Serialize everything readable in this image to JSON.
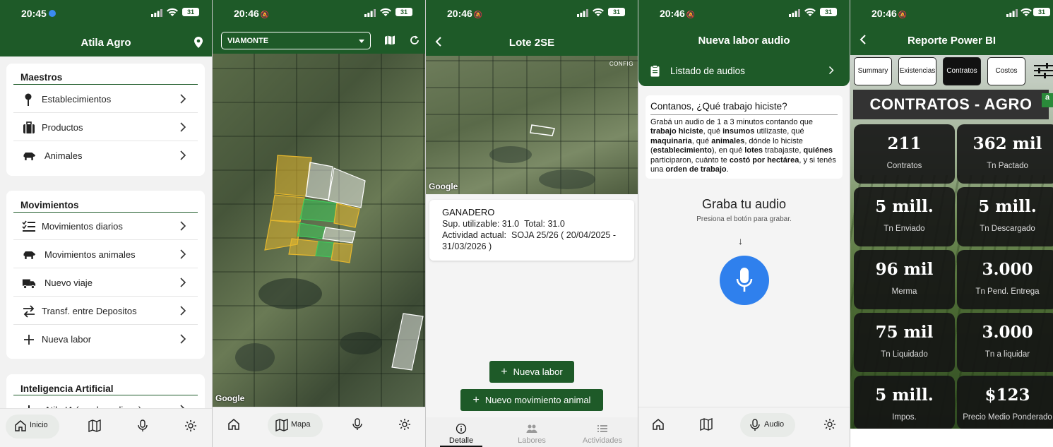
{
  "colors": {
    "brand_green": "#1e5a28",
    "mic_blue": "#2f80ed",
    "map_polygon_yellow": "#e6b82e",
    "map_polygon_green": "#3ec85a"
  },
  "screen1": {
    "status_time": "20:45",
    "battery": "31",
    "title": "Atila Agro",
    "sections": [
      {
        "title": "Maestros",
        "items": [
          {
            "label": "Establecimientos",
            "icon": "pin-icon"
          },
          {
            "label": "Productos",
            "icon": "briefcase-icon"
          },
          {
            "label": "Animales",
            "icon": "cow-icon"
          }
        ]
      },
      {
        "title": "Movimientos",
        "items": [
          {
            "label": "Movimientos diarios",
            "icon": "checklist-icon"
          },
          {
            "label": "Movimientos animales",
            "icon": "cow-icon"
          },
          {
            "label": "Nuevo viaje",
            "icon": "truck-icon"
          },
          {
            "label": "Transf. entre Depositos",
            "icon": "swap-icon"
          },
          {
            "label": "Nueva labor",
            "icon": "plus-icon"
          }
        ]
      },
      {
        "title": "Inteligencia Artificial",
        "items": [
          {
            "label": "Atila IA (ayuda en linea)",
            "icon": "robot-icon"
          }
        ]
      }
    ],
    "nav": {
      "home_label": "Inicio"
    }
  },
  "screen2": {
    "status_time": "20:46",
    "battery": "31",
    "establishment_selected": "VIAMONTE",
    "google_label": "Google",
    "nav": {
      "map_label": "Mapa"
    }
  },
  "screen3": {
    "status_time": "20:46",
    "battery": "31",
    "title": "Lote 2SE",
    "config_label": "CONFIG",
    "google_label": "Google",
    "lot": {
      "name": "GANADERO",
      "usable_label": "Sup. utilizable:",
      "usable_value": "31.0",
      "total_label": "Total:",
      "total_value": "31.0",
      "activity_label": "Actividad actual:",
      "activity_line1": "SOJA 25/26 ( 20/04/2025 -",
      "activity_line2": "31/03/2026 )"
    },
    "btn_new_labor": "Nueva labor",
    "btn_new_animal_move": "Nuevo movimiento animal",
    "tabs": [
      "Detalle",
      "Labores",
      "Actividades"
    ]
  },
  "screen4": {
    "status_time": "20:46",
    "battery": "31",
    "title": "Nueva labor audio",
    "list_label": "Listado de audios",
    "question_title": "Contanos, ¿Qué trabajo hiciste?",
    "instructions": [
      {
        "t": "Grabá un audio de 1 a 3 minutos contando que ",
        "b": false
      },
      {
        "t": "trabajo hiciste",
        "b": true
      },
      {
        "t": ", qué ",
        "b": false
      },
      {
        "t": "insumos",
        "b": true
      },
      {
        "t": " utilizaste, qué ",
        "b": false
      },
      {
        "t": "maquinaria",
        "b": true
      },
      {
        "t": ", qué ",
        "b": false
      },
      {
        "t": "animales",
        "b": true
      },
      {
        "t": ", dónde lo hiciste (",
        "b": false
      },
      {
        "t": "establecimiento",
        "b": true
      },
      {
        "t": "), en qué ",
        "b": false
      },
      {
        "t": "lotes",
        "b": true
      },
      {
        "t": " trabajaste, ",
        "b": false
      },
      {
        "t": "quiénes",
        "b": true
      },
      {
        "t": " participaron, cuánto te ",
        "b": false
      },
      {
        "t": "costó por hectárea",
        "b": true
      },
      {
        "t": ", y si tenés una ",
        "b": false
      },
      {
        "t": "orden de trabajo",
        "b": true
      },
      {
        "t": ".",
        "b": false
      }
    ],
    "record_title": "Graba tu audio",
    "record_hint": "Presiona el botón para grabar.",
    "nav": {
      "audio_label": "Audio"
    }
  },
  "screen5": {
    "status_time": "20:46",
    "battery": "31",
    "title": "Reporte Power BI",
    "tabs": [
      {
        "label": "Summary",
        "active": false
      },
      {
        "label": "Existencias",
        "active": false
      },
      {
        "label": "Contratos",
        "active": true
      },
      {
        "label": "Costos",
        "active": false
      }
    ],
    "report_title": "CONTRATOS - AGRO",
    "kpis": [
      {
        "value": "211",
        "label": "Contratos"
      },
      {
        "value": "362 mil",
        "label": "Tn Pactado"
      },
      {
        "value": "5 mill.",
        "label": "Tn Enviado"
      },
      {
        "value": "5 mill.",
        "label": "Tn Descargado"
      },
      {
        "value": "96 mil",
        "label": "Merma"
      },
      {
        "value": "3.000",
        "label": "Tn Pend. Entrega"
      },
      {
        "value": "75 mil",
        "label": "Tn Liquidado"
      },
      {
        "value": "3.000",
        "label": "Tn a liquidar"
      },
      {
        "value": "5 mill.",
        "label": "Impos."
      },
      {
        "value": "$123",
        "label": "Precio Medio Ponderado"
      }
    ]
  }
}
